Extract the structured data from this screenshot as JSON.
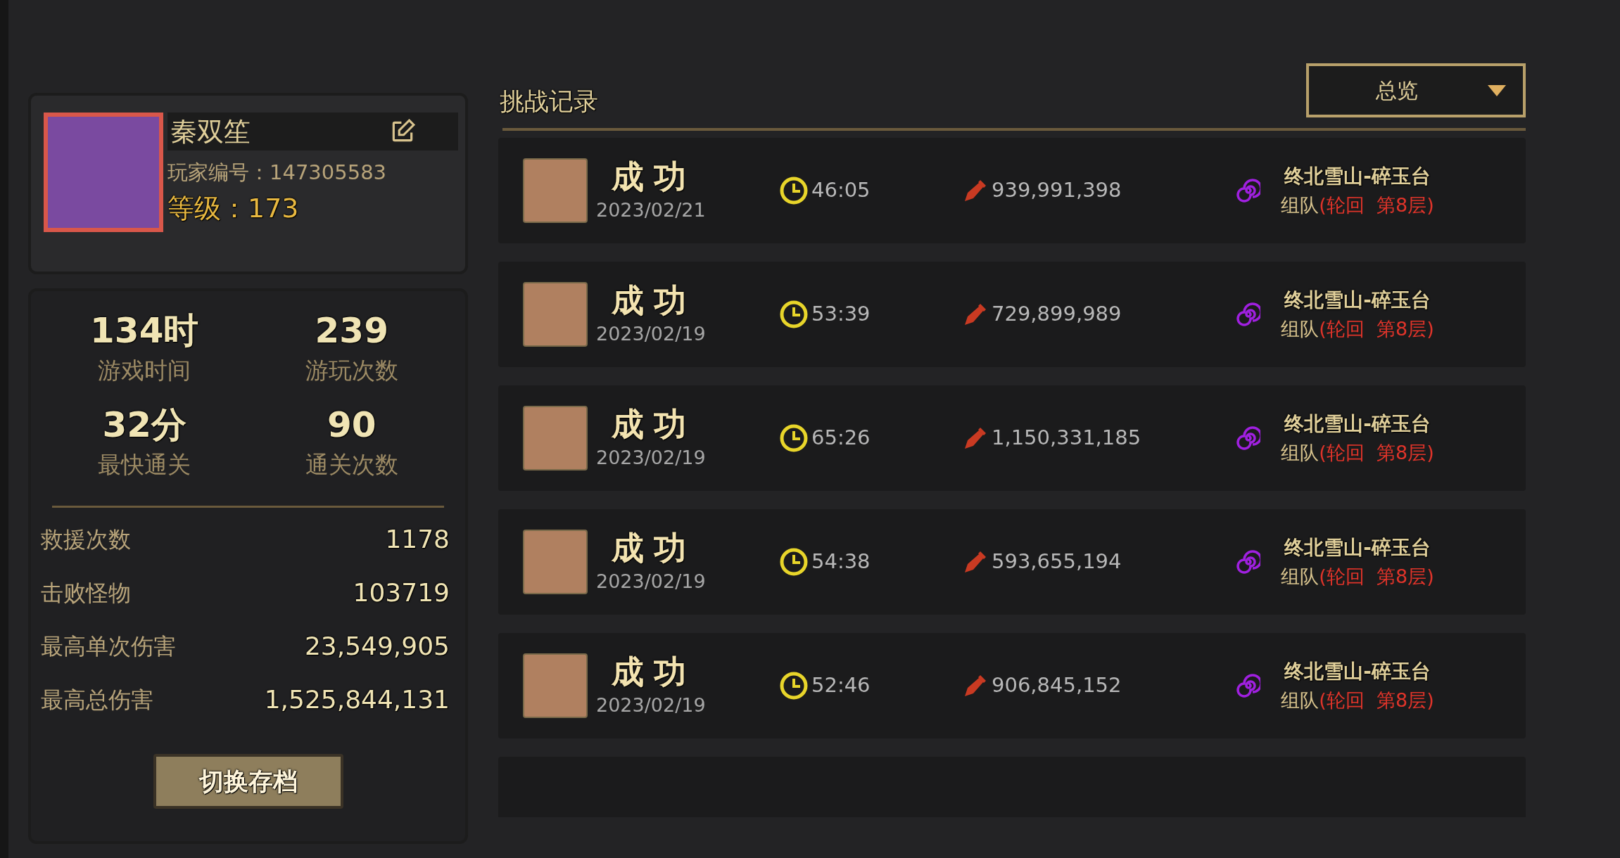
{
  "profile": {
    "name": "秦双笙",
    "player_id": "玩家编号：147305583",
    "level": "等级：173"
  },
  "summary": [
    {
      "value": "134时",
      "label": "游戏时间"
    },
    {
      "value": "239",
      "label": "游玩次数"
    },
    {
      "value": "32分",
      "label": "最快通关"
    },
    {
      "value": "90",
      "label": "通关次数"
    }
  ],
  "details": [
    {
      "label": "救援次数",
      "value": "1178"
    },
    {
      "label": "击败怪物",
      "value": "103719"
    },
    {
      "label": "最高单次伤害",
      "value": "23,549,905"
    },
    {
      "label": "最高总伤害",
      "value": "1,525,844,131"
    }
  ],
  "switch_button": "切换存档",
  "records": {
    "title": "挑战记录",
    "filter": "总览",
    "rows": [
      {
        "result": "成功",
        "date": "2023/02/21",
        "time": "46:05",
        "damage": "939,991,398",
        "location": "终北雪山-碎玉台",
        "mode": "组队",
        "detail": "(轮回  第8层)"
      },
      {
        "result": "成功",
        "date": "2023/02/19",
        "time": "53:39",
        "damage": "729,899,989",
        "location": "终北雪山-碎玉台",
        "mode": "组队",
        "detail": "(轮回  第8层)"
      },
      {
        "result": "成功",
        "date": "2023/02/19",
        "time": "65:26",
        "damage": "1,150,331,185",
        "location": "终北雪山-碎玉台",
        "mode": "组队",
        "detail": "(轮回  第8层)"
      },
      {
        "result": "成功",
        "date": "2023/02/19",
        "time": "54:38",
        "damage": "593,655,194",
        "location": "终北雪山-碎玉台",
        "mode": "组队",
        "detail": "(轮回  第8层)"
      },
      {
        "result": "成功",
        "date": "2023/02/19",
        "time": "52:46",
        "damage": "906,845,152",
        "location": "终北雪山-碎玉台",
        "mode": "组队",
        "detail": "(轮回  第8层)"
      }
    ]
  }
}
